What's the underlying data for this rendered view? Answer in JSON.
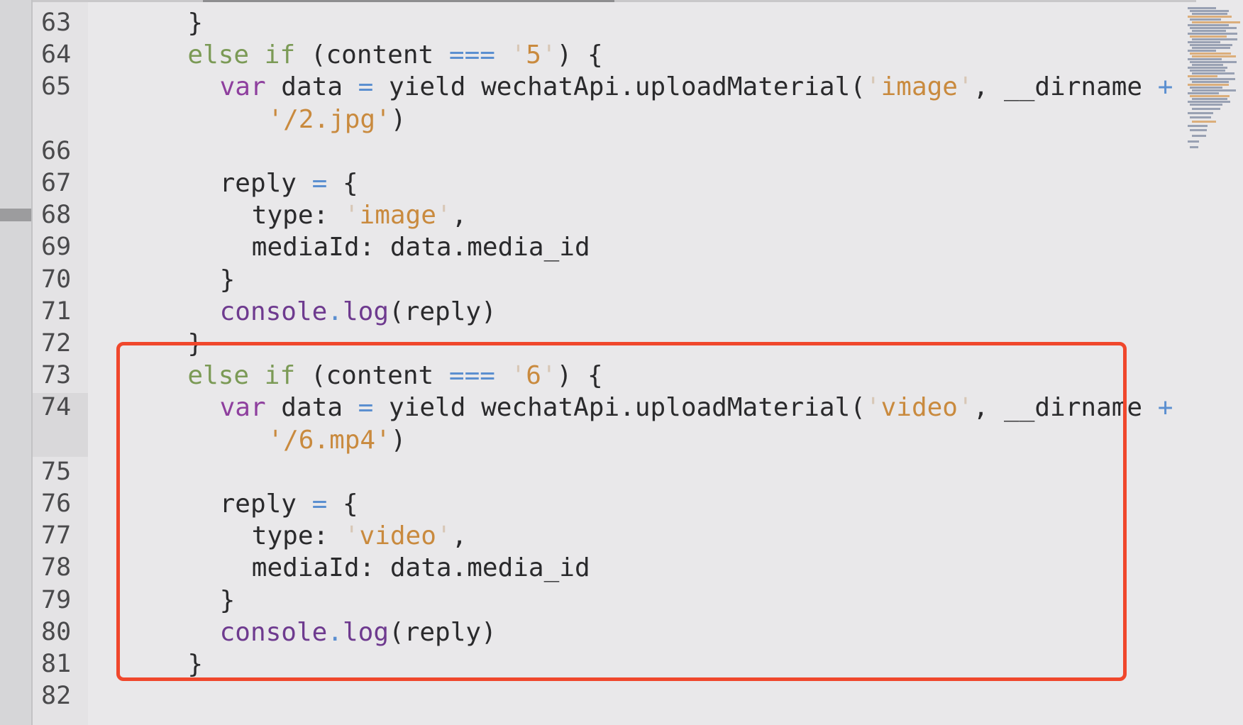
{
  "editor": {
    "lines": [
      {
        "num": "63",
        "indent": 4,
        "tokens": [
          {
            "t": "}",
            "c": ""
          }
        ]
      },
      {
        "num": "64",
        "indent": 4,
        "tokens": [
          {
            "t": "else",
            "c": "kw"
          },
          {
            "t": " ",
            "c": ""
          },
          {
            "t": "if",
            "c": "kw"
          },
          {
            "t": " (content ",
            "c": ""
          },
          {
            "t": "===",
            "c": "op"
          },
          {
            "t": " ",
            "c": ""
          },
          {
            "t": "'",
            "c": "sq"
          },
          {
            "t": "5",
            "c": "str"
          },
          {
            "t": "'",
            "c": "sq"
          },
          {
            "t": ") {",
            "c": ""
          }
        ]
      },
      {
        "num": "65",
        "indent": 6,
        "tokens": [
          {
            "t": "var",
            "c": "var"
          },
          {
            "t": " data ",
            "c": ""
          },
          {
            "t": "=",
            "c": "op"
          },
          {
            "t": " yield wechatApi.uploadMaterial(",
            "c": ""
          },
          {
            "t": "'",
            "c": "sq"
          },
          {
            "t": "image",
            "c": "str"
          },
          {
            "t": "'",
            "c": "sq"
          },
          {
            "t": ", __dirname ",
            "c": ""
          },
          {
            "t": "+",
            "c": "op"
          }
        ]
      },
      {
        "num": "",
        "indent": 9,
        "tokens": [
          {
            "t": "'/2.jpg'",
            "c": "str"
          },
          {
            "t": ")",
            "c": ""
          }
        ]
      },
      {
        "num": "66",
        "indent": 0,
        "tokens": []
      },
      {
        "num": "67",
        "indent": 6,
        "tokens": [
          {
            "t": "reply ",
            "c": ""
          },
          {
            "t": "=",
            "c": "op"
          },
          {
            "t": " {",
            "c": ""
          }
        ]
      },
      {
        "num": "68",
        "indent": 8,
        "tokens": [
          {
            "t": "type: ",
            "c": ""
          },
          {
            "t": "'",
            "c": "sq"
          },
          {
            "t": "image",
            "c": "str"
          },
          {
            "t": "'",
            "c": "sq"
          },
          {
            "t": ",",
            "c": ""
          }
        ]
      },
      {
        "num": "69",
        "indent": 8,
        "tokens": [
          {
            "t": "mediaId: data.media_id",
            "c": ""
          }
        ]
      },
      {
        "num": "70",
        "indent": 6,
        "tokens": [
          {
            "t": "}",
            "c": ""
          }
        ]
      },
      {
        "num": "71",
        "indent": 6,
        "tokens": [
          {
            "t": "console",
            "c": "fn"
          },
          {
            "t": ".",
            "c": "op"
          },
          {
            "t": "log",
            "c": "fn"
          },
          {
            "t": "(reply)",
            "c": ""
          }
        ]
      },
      {
        "num": "72",
        "indent": 4,
        "tokens": [
          {
            "t": "}",
            "c": ""
          }
        ]
      },
      {
        "num": "73",
        "indent": 4,
        "tokens": [
          {
            "t": "else",
            "c": "kw"
          },
          {
            "t": " ",
            "c": ""
          },
          {
            "t": "if",
            "c": "kw"
          },
          {
            "t": " (content ",
            "c": ""
          },
          {
            "t": "===",
            "c": "op"
          },
          {
            "t": " ",
            "c": ""
          },
          {
            "t": "'",
            "c": "sq"
          },
          {
            "t": "6",
            "c": "str"
          },
          {
            "t": "'",
            "c": "sq"
          },
          {
            "t": ") {",
            "c": ""
          }
        ]
      },
      {
        "num": "74",
        "indent": 6,
        "tokens": [
          {
            "t": "var",
            "c": "var"
          },
          {
            "t": " data ",
            "c": ""
          },
          {
            "t": "=",
            "c": "op"
          },
          {
            "t": " yield wechatApi.uploadMaterial(",
            "c": ""
          },
          {
            "t": "'",
            "c": "sq"
          },
          {
            "t": "video",
            "c": "str"
          },
          {
            "t": "'",
            "c": "sq"
          },
          {
            "t": ", __dirname ",
            "c": ""
          },
          {
            "t": "+",
            "c": "op"
          }
        ]
      },
      {
        "num": "",
        "indent": 9,
        "tokens": [
          {
            "t": "'/6.mp4'",
            "c": "str"
          },
          {
            "t": ")",
            "c": ""
          }
        ]
      },
      {
        "num": "75",
        "indent": 0,
        "tokens": []
      },
      {
        "num": "76",
        "indent": 6,
        "tokens": [
          {
            "t": "reply ",
            "c": ""
          },
          {
            "t": "=",
            "c": "op"
          },
          {
            "t": " {",
            "c": ""
          }
        ]
      },
      {
        "num": "77",
        "indent": 8,
        "tokens": [
          {
            "t": "type: ",
            "c": ""
          },
          {
            "t": "'",
            "c": "sq"
          },
          {
            "t": "video",
            "c": "str"
          },
          {
            "t": "'",
            "c": "sq"
          },
          {
            "t": ",",
            "c": ""
          }
        ]
      },
      {
        "num": "78",
        "indent": 8,
        "tokens": [
          {
            "t": "mediaId: data.media_id",
            "c": ""
          }
        ]
      },
      {
        "num": "79",
        "indent": 6,
        "tokens": [
          {
            "t": "}",
            "c": ""
          }
        ]
      },
      {
        "num": "80",
        "indent": 6,
        "tokens": [
          {
            "t": "console",
            "c": "fn"
          },
          {
            "t": ".",
            "c": "op"
          },
          {
            "t": "log",
            "c": "fn"
          },
          {
            "t": "(reply)",
            "c": ""
          }
        ]
      },
      {
        "num": "81",
        "indent": 4,
        "tokens": [
          {
            "t": "}",
            "c": ""
          }
        ]
      },
      {
        "num": "82",
        "indent": 0,
        "tokens": []
      }
    ]
  },
  "colors": {
    "keyword": "#7b9a56",
    "var_keyword": "#8e3f9e",
    "operator": "#5b8fd0",
    "string": "#c98a3e",
    "highlight_box": "#f0472c",
    "background": "#e9e8ea"
  }
}
